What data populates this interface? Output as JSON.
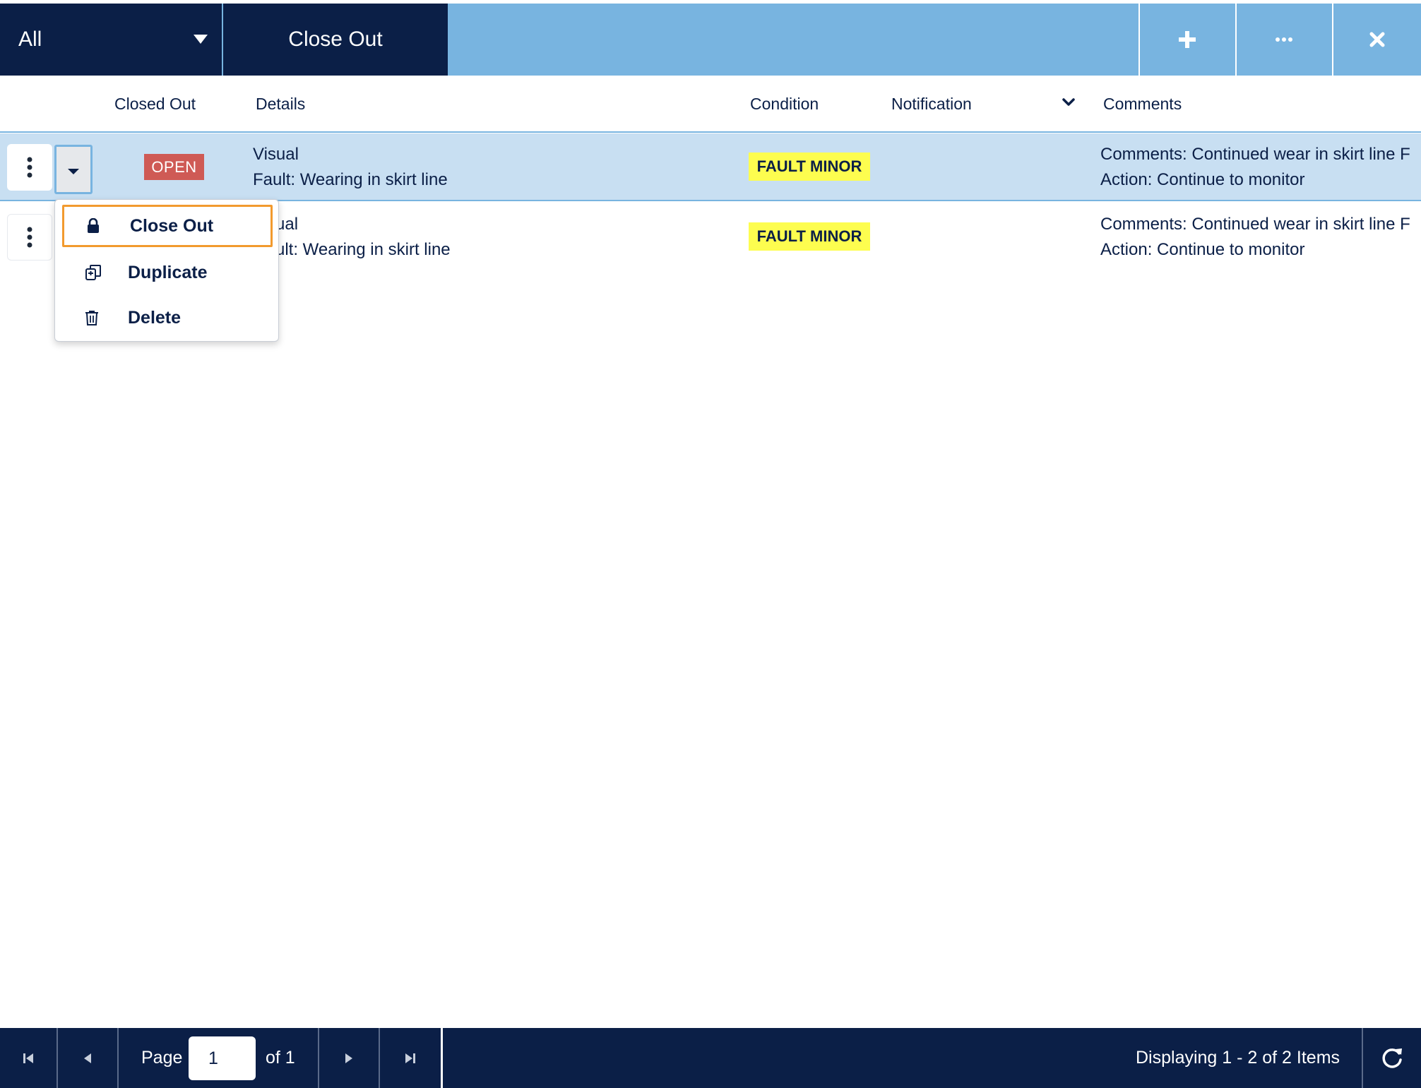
{
  "toolbar": {
    "filter": {
      "value": "All",
      "icon": "caret-down-icon"
    },
    "close_out_label": "Close Out",
    "buttons": [
      {
        "name": "add",
        "icon": "plus-icon"
      },
      {
        "name": "more",
        "icon": "ellipsis-icon"
      },
      {
        "name": "close",
        "icon": "close-icon"
      }
    ]
  },
  "columns": {
    "closed_out": "Closed Out",
    "details": "Details",
    "condition": "Condition",
    "notification": "Notification",
    "comments": "Comments"
  },
  "rows": [
    {
      "status": "OPEN",
      "details_line1": "Visual",
      "details_line2": "Fault: Wearing in skirt line",
      "condition": "FAULT MINOR",
      "comments_line1": "Comments: Continued wear in skirt line F",
      "comments_line2": "Action: Continue to monitor",
      "selected": true
    },
    {
      "details_line1": "ual",
      "details_line2": "ult: Wearing in skirt line",
      "condition": "FAULT MINOR",
      "comments_line1": "Comments: Continued wear in skirt line F",
      "comments_line2": "Action: Continue to monitor",
      "selected": false
    }
  ],
  "context_menu": {
    "items": [
      {
        "label": "Close Out",
        "icon": "lock-icon",
        "focused": true
      },
      {
        "label": "Duplicate",
        "icon": "duplicate-icon",
        "focused": false
      },
      {
        "label": "Delete",
        "icon": "trash-icon",
        "focused": false
      }
    ]
  },
  "pager": {
    "page_label": "Page",
    "page_value": "1",
    "of_label": "of 1",
    "display_text": "Displaying 1 - 2 of 2 Items"
  },
  "colors": {
    "navy": "#0b1f47",
    "light_blue": "#78b4e0",
    "selected_row": "#c8dff2",
    "open_badge": "#cf5a55",
    "fault_badge": "#fdfd4f",
    "focus_outline": "#f29a2e"
  }
}
